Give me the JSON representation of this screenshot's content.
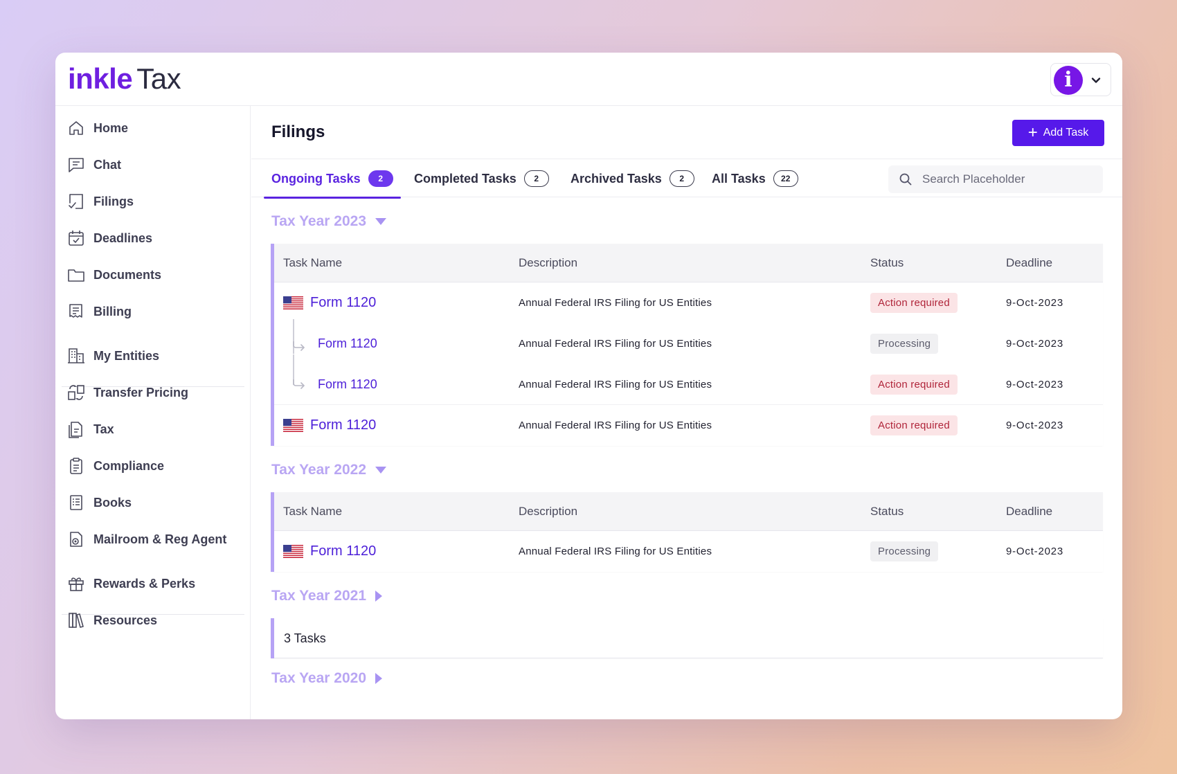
{
  "app": {
    "brand": "inkle",
    "product": "Tax",
    "avatar_letter": "i"
  },
  "sidebar": {
    "items": [
      {
        "label": "Home",
        "icon": "home-icon"
      },
      {
        "label": "Chat",
        "icon": "chat-icon"
      },
      {
        "label": "Filings",
        "icon": "filings-icon"
      },
      {
        "label": "Deadlines",
        "icon": "calendar-icon"
      },
      {
        "label": "Documents",
        "icon": "folder-icon"
      },
      {
        "label": "Billing",
        "icon": "billing-icon"
      },
      {
        "label": "My Entities",
        "icon": "entities-icon"
      },
      {
        "label": "Transfer Pricing",
        "icon": "transfer-pricing-icon"
      },
      {
        "label": "Tax",
        "icon": "tax-doc-icon"
      },
      {
        "label": "Compliance",
        "icon": "clipboard-icon"
      },
      {
        "label": "Books",
        "icon": "books-icon"
      },
      {
        "label": "Mailroom & Reg Agent",
        "icon": "mailroom-icon"
      },
      {
        "label": "Rewards & Perks",
        "icon": "gift-icon"
      },
      {
        "label": "Resources",
        "icon": "library-icon"
      }
    ]
  },
  "main": {
    "title": "Filings",
    "add_task_label": "Add Task",
    "tabs": [
      {
        "label": "Ongoing Tasks",
        "count": "2"
      },
      {
        "label": "Completed Tasks",
        "count": "2"
      },
      {
        "label": "Archived Tasks",
        "count": "2"
      },
      {
        "label": "All Tasks",
        "count": "22"
      }
    ],
    "search_placeholder": "Search Placeholder",
    "columns": {
      "task": "Task Name",
      "description": "Description",
      "status": "Status",
      "deadline": "Deadline"
    },
    "years": [
      {
        "label": "Tax Year 2023",
        "rows": [
          {
            "task": "Form 1120",
            "description": "Annual Federal IRS Filing for US Entities",
            "status": "Action required",
            "deadline": "9-Oct-2023"
          },
          {
            "task": "Form 1120",
            "description": "Annual Federal IRS Filing for US Entities",
            "status": "Processing",
            "deadline": "9-Oct-2023"
          },
          {
            "task": "Form 1120",
            "description": "Annual Federal IRS Filing for US Entities",
            "status": "Action required",
            "deadline": "9-Oct-2023"
          },
          {
            "task": "Form 1120",
            "description": "Annual Federal IRS Filing for US Entities",
            "status": "Action required",
            "deadline": "9-Oct-2023"
          }
        ]
      },
      {
        "label": "Tax Year 2022",
        "rows": [
          {
            "task": "Form 1120",
            "description": "Annual Federal IRS Filing for US Entities",
            "status": "Processing",
            "deadline": "9-Oct-2023"
          }
        ]
      },
      {
        "label": "Tax Year 2021",
        "summary": "3 Tasks"
      },
      {
        "label": "Tax Year 2020"
      }
    ]
  },
  "colors": {
    "brand": "#6e1fe0",
    "primary_button": "#5619ea",
    "accent_line": "#b6a2f5",
    "action_bg": "#fbe4e6",
    "action_text": "#b0253a"
  }
}
